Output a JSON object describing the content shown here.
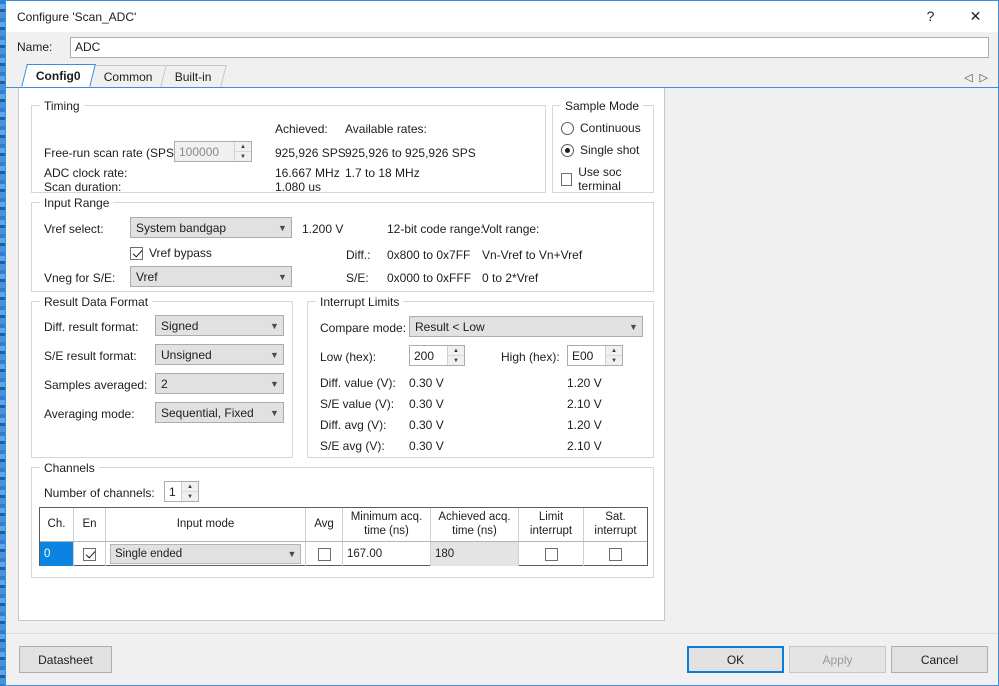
{
  "window": {
    "title": "Configure 'Scan_ADC'",
    "help_icon": "?",
    "close_icon": "✕"
  },
  "name_row": {
    "label": "Name:",
    "value": "ADC"
  },
  "tabs": [
    {
      "label": "Config0",
      "active": true
    },
    {
      "label": "Common",
      "active": false
    },
    {
      "label": "Built-in",
      "active": false
    }
  ],
  "tab_nav": {
    "prev": "◁",
    "next": "▷"
  },
  "timing": {
    "legend": "Timing",
    "col_achieved": "Achieved:",
    "col_available": "Available rates:",
    "scan_rate_label": "Free-run scan rate (SPS):",
    "scan_rate_value": "100000",
    "scan_rate_achieved": "925,926 SPS",
    "scan_rate_available": "925,926 to 925,926 SPS",
    "adc_clock_label": "ADC clock rate:",
    "adc_clock_achieved": "16.667 MHz",
    "adc_clock_available": "1.7 to 18 MHz",
    "scan_duration_label": "Scan duration:",
    "scan_duration_achieved": "1.080 us"
  },
  "sample_mode": {
    "legend": "Sample Mode",
    "options": [
      {
        "label": "Continuous",
        "selected": false
      },
      {
        "label": "Single shot",
        "selected": true
      }
    ],
    "soc_terminal_label": "Use soc terminal",
    "soc_terminal_checked": false
  },
  "input_range": {
    "legend": "Input Range",
    "vref_select_label": "Vref select:",
    "vref_select_value": "System bandgap",
    "vref_voltage": "1.200 V",
    "vref_bypass_label": "Vref bypass",
    "vref_bypass_checked": true,
    "vneg_label": "Vneg for S/E:",
    "vneg_value": "Vref",
    "code_range_header": "12-bit code range:",
    "volt_range_header": "Volt range:",
    "rows": [
      {
        "name": "Diff.:",
        "code": "0x800 to 0x7FF",
        "volt": "Vn-Vref to Vn+Vref"
      },
      {
        "name": "S/E:",
        "code": "0x000 to 0xFFF",
        "volt": "0 to 2*Vref"
      }
    ]
  },
  "result_format": {
    "legend": "Result Data Format",
    "fields": [
      {
        "label": "Diff. result format:",
        "value": "Signed"
      },
      {
        "label": "S/E result format:",
        "value": "Unsigned"
      },
      {
        "label": "Samples averaged:",
        "value": "2"
      },
      {
        "label": "Averaging mode:",
        "value": "Sequential, Fixed"
      }
    ]
  },
  "interrupt_limits": {
    "legend": "Interrupt Limits",
    "compare_mode_label": "Compare mode:",
    "compare_mode_value": "Result < Low",
    "low_label": "Low (hex):",
    "low_value": "200",
    "high_label": "High (hex):",
    "high_value": "E00",
    "rows": [
      {
        "label": "Diff. value (V):",
        "low": "0.30 V",
        "high": "1.20 V"
      },
      {
        "label": "S/E value (V):",
        "low": "0.30 V",
        "high": "2.10 V"
      },
      {
        "label": "Diff. avg (V):",
        "low": "0.30 V",
        "high": "1.20 V"
      },
      {
        "label": "S/E avg (V):",
        "low": "0.30 V",
        "high": "2.10 V"
      }
    ]
  },
  "channels": {
    "legend": "Channels",
    "count_label": "Number of channels:",
    "count_value": "1",
    "headers": [
      "Ch.",
      "En",
      "Input mode",
      "Avg",
      "Minimum acq.\ntime (ns)",
      "Achieved acq.\ntime (ns)",
      "Limit\ninterrupt",
      "Sat.\ninterrupt"
    ],
    "header_lines": [
      [
        "Ch."
      ],
      [
        "En"
      ],
      [
        "Input mode"
      ],
      [
        "Avg"
      ],
      [
        "Minimum acq.",
        "time (ns)"
      ],
      [
        "Achieved acq.",
        "time (ns)"
      ],
      [
        "Limit",
        "interrupt"
      ],
      [
        "Sat.",
        "interrupt"
      ]
    ],
    "rows": [
      {
        "ch": "0",
        "en_checked": true,
        "input_mode": "Single ended",
        "avg_checked": false,
        "min_acq_time": "167.00",
        "achieved_acq_time": "180",
        "limit_interrupt_checked": false,
        "sat_interrupt_checked": false
      }
    ]
  },
  "footer": {
    "datasheet": "Datasheet",
    "ok": "OK",
    "apply": "Apply",
    "cancel": "Cancel"
  },
  "colors": {
    "accent": "#0a7ddb",
    "selection": "#0a84e0",
    "dialog_border": "#3c8de0",
    "panel_bg": "#ffffff",
    "chrome_bg": "#f0f0f0"
  }
}
